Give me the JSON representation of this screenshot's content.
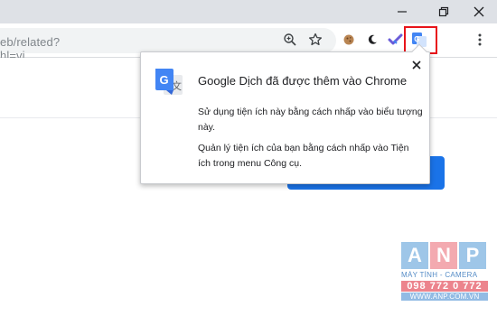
{
  "browser": {
    "url_text": "eb/related?hl=vi",
    "icons": {
      "minimize": "minimize-icon",
      "maximize": "restore-icon",
      "close": "close-icon",
      "zoom": "zoom-icon",
      "bookmark": "star-icon",
      "menu": "more-vert-icon"
    },
    "extensions": [
      "cookie-extension-icon",
      "moon-extension-icon",
      "checkmark-extension-icon",
      "google-translate-extension-icon"
    ],
    "highlight_color": "#e8141a"
  },
  "popup": {
    "title": "Google Dịch đã được thêm vào Chrome",
    "text_1": "Sử dụng tiện ích này bằng cách nhấp vào biểu tượng này.",
    "text_2": "Quản lý tiện ích của bạn bằng cách nhấp vào Tiện ích trong menu Công cụ.",
    "close_icon": "close-icon"
  },
  "page": {
    "accent_color": "#1a73e8"
  },
  "watermark": {
    "letters": [
      "A",
      "N",
      "P"
    ],
    "subtitle": "MÁY TÍNH - CAMERA",
    "phone": "098 772 0 772",
    "site": "WWW.ANP.COM.VN"
  }
}
